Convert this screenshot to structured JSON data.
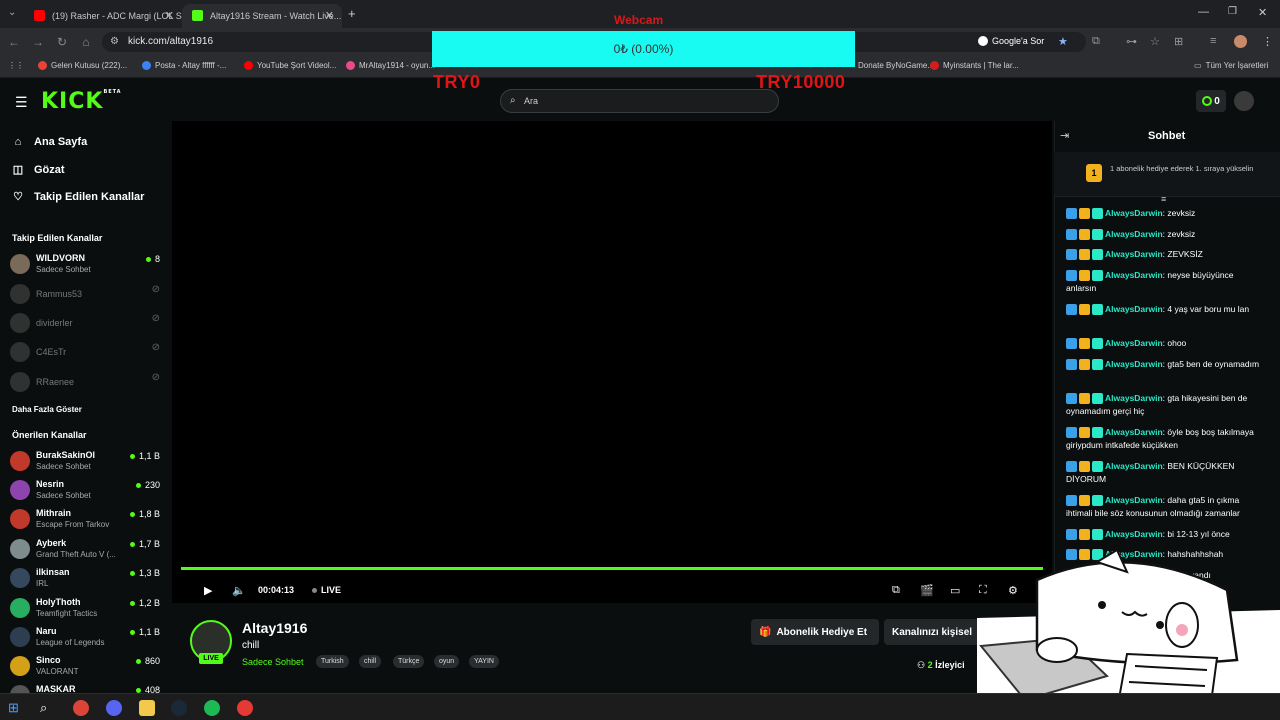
{
  "browser": {
    "tabs": [
      {
        "title": "(19) Rasher - ADC Margi (LOL S...",
        "color": "#ff0000"
      },
      {
        "title": "Altay1916 Stream - Watch Live...",
        "color": "#53fc18"
      }
    ],
    "url": "kick.com/altay1916",
    "google_btn": "Google'a Sor",
    "bookmarks": [
      {
        "label": "Gelen Kutusu (222)...",
        "color": "#ea4335"
      },
      {
        "label": "Posta - Altay ffffff -...",
        "color": "#3b82f6"
      },
      {
        "label": "YouTube Şort Videol...",
        "color": "#ff0000"
      },
      {
        "label": "MrAltay1914 - oyun...",
        "color": "#e94a8a"
      },
      {
        "label": "Donate ByNoGame...",
        "color": "#f5a623"
      },
      {
        "label": "Myinstants | The lar...",
        "color": "#d21d1d"
      }
    ],
    "bookmarks_all": "Tüm Yer İşaretleri"
  },
  "overlay": {
    "webcam_label": "Webcam",
    "donation_progress": "0₺ (0.00%)",
    "goal_min": "TRY0",
    "goal_max": "TRY10000"
  },
  "header": {
    "logo": "KICK",
    "logo_beta": "BETA",
    "search_placeholder": "Ara",
    "credits": "0"
  },
  "sidebar": {
    "nav": [
      {
        "label": "Ana Sayfa",
        "icon": "home-icon"
      },
      {
        "label": "Gözat",
        "icon": "browse-icon"
      },
      {
        "label": "Takip Edilen Kanallar",
        "icon": "heart-icon"
      }
    ],
    "followed_title": "Takip Edilen Kanallar",
    "followed": [
      {
        "name": "WILDVORN",
        "category": "Sadece Sohbet",
        "viewers": "8",
        "online": true
      },
      {
        "name": "Rammus53",
        "online": false
      },
      {
        "name": "dividerler",
        "online": false
      },
      {
        "name": "C4EsTr",
        "online": false
      },
      {
        "name": "RRaenee",
        "online": false
      }
    ],
    "show_more": "Daha Fazla Göster",
    "recommended_title": "Önerilen Kanallar",
    "recommended": [
      {
        "name": "BurakSakinOl",
        "category": "Sadece Sohbet",
        "viewers": "1,1 B",
        "color": "#c0392b"
      },
      {
        "name": "Nesrin",
        "category": "Sadece Sohbet",
        "viewers": "230",
        "color": "#8e44ad"
      },
      {
        "name": "Mithrain",
        "category": "Escape From Tarkov",
        "viewers": "1,8 B",
        "color": "#c0392b"
      },
      {
        "name": "Ayberk",
        "category": "Grand Theft Auto V (...",
        "viewers": "1,7 B",
        "color": "#7f8c8d"
      },
      {
        "name": "ilkinsan",
        "category": "IRL",
        "viewers": "1,3 B",
        "color": "#34495e"
      },
      {
        "name": "HolyThoth",
        "category": "Teamfight Tactics",
        "viewers": "1,2 B",
        "color": "#27ae60"
      },
      {
        "name": "Naru",
        "category": "League of Legends",
        "viewers": "1,1 B",
        "color": "#2c3e50"
      },
      {
        "name": "Sinco",
        "category": "VALORANT",
        "viewers": "860",
        "color": "#d4a017"
      },
      {
        "name": "MASKAR",
        "category": "",
        "viewers": "408",
        "color": "#555555"
      }
    ]
  },
  "player": {
    "time": "00:04:13",
    "live": "LIVE"
  },
  "channel": {
    "name": "Altay1916",
    "live_badge": "LIVE",
    "title": "chill",
    "category": "Sadece Sohbet",
    "tags": [
      "Turkish",
      "chill",
      "Türkçe",
      "oyun",
      "YAYIN"
    ],
    "gift_btn": "Abonelik Hediye Et",
    "customize_btn": "Kanalınızı kişisel",
    "viewers_count": "2",
    "viewers_label": "İzleyici"
  },
  "chat": {
    "title": "Sohbet",
    "promo_rank": "1",
    "promo_text": "1 abonelik hediye ederek 1. sıraya yükselin",
    "messages": [
      {
        "user": "AlwaysDarwin",
        "text": "zevksiz"
      },
      {
        "user": "AlwaysDarwin",
        "text": "zevksiz"
      },
      {
        "user": "AlwaysDarwin",
        "text": "ZEVKSİZ"
      },
      {
        "user": "AlwaysDarwin",
        "text": "neyse büyüyünce anlarsın"
      },
      {
        "user": "AlwaysDarwin",
        "text": "4 yaş var boru mu lan"
      },
      {
        "user": "AlwaysDarwin",
        "text": "ohoo"
      },
      {
        "user": "AlwaysDarwin",
        "text": "gta5 ben de oynamadım"
      },
      {
        "user": "AlwaysDarwin",
        "text": "gta hikayesini ben de oynamadım gerçi hiç"
      },
      {
        "user": "AlwaysDarwin",
        "text": "öyle boş boş takılmaya giriypdum intkafede küçükken"
      },
      {
        "user": "AlwaysDarwin",
        "text": "BEN KÜÇÜKKEN DİYORUM"
      },
      {
        "user": "AlwaysDarwin",
        "text": "daha gta5 in çıkma ihtimali bile söz konusunun olmadığı zamanlar"
      },
      {
        "user": "AlwaysDarwin",
        "text": "bi 12-13 yıl önce"
      },
      {
        "user": "AlwaysDarwin",
        "text": "hahshahhshah"
      },
      {
        "user": "AlwaysDarwin",
        "text": "beyni yandı"
      }
    ]
  },
  "colors": {
    "kick_green": "#53fc18",
    "chat_user": "#2ae8c8",
    "overlay_cyan": "#17fbf2",
    "overlay_red": "#e01515"
  }
}
